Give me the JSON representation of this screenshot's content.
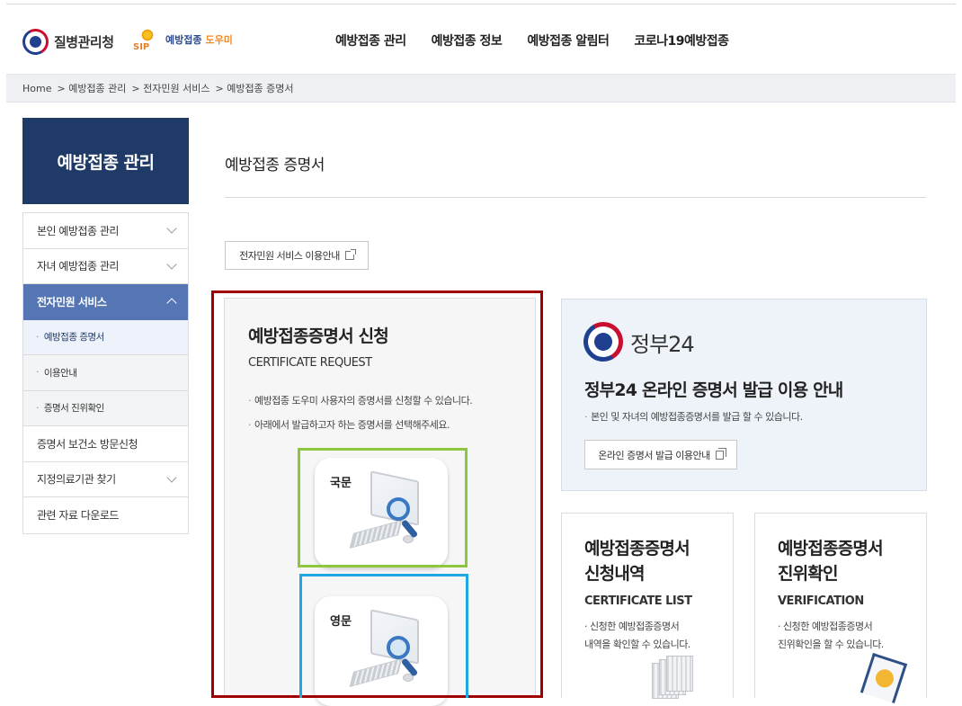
{
  "header": {
    "org_name": "질병관리청",
    "site_logo_sip": "SIP",
    "site_name_1": "예방접종",
    "site_name_2": "도우미",
    "nav": [
      "예방접종 관리",
      "예방접종 정보",
      "예방접종 알림터",
      "코로나19예방접종"
    ]
  },
  "breadcrumb": [
    "Home",
    "> 예방접종 관리",
    "> 전자민원 서비스",
    "> 예방접종 증명서"
  ],
  "sidebar": {
    "title": "예방접종 관리",
    "items": [
      {
        "label": "본인 예방접종 관리"
      },
      {
        "label": "자녀 예방접종 관리"
      },
      {
        "label": "전자민원 서비스"
      },
      {
        "label": "예방접종 증명서"
      },
      {
        "label": "이용안내"
      },
      {
        "label": "증명서 진위확인"
      },
      {
        "label": "증명서 보건소 방문신청"
      },
      {
        "label": "지정의료기관 찾기"
      },
      {
        "label": "관련 자료 다운로드"
      }
    ]
  },
  "main": {
    "page_title": "예방접종 증명서",
    "guide_button": "전자민원 서비스 이용안내",
    "request_card": {
      "title": "예방접종증명서 신청",
      "subtitle": "CERTIFICATE REQUEST",
      "bullets": [
        "예방접종 도우미 사용자의 증명서를 신청할 수 있습니다.",
        "아래에서 발급하고자 하는 증명서를 선택해주세요."
      ],
      "korean_label": "국문",
      "english_label": "영문"
    },
    "gov24_card": {
      "logo_text": "정부24",
      "title": "정부24 온라인 증명서 발급 이용 안내",
      "desc": "본인 및 자녀의 예방접종증명서를 발급 할 수 있습니다.",
      "button": "온라인 증명서 발급 이용안내"
    },
    "list_card": {
      "title": "예방접종증명서\n신청내역",
      "subtitle": "CERTIFICATE LIST",
      "desc": "· 신청한 예방접종증명서\n   내역을 확인할 수 있습니다."
    },
    "verify_card": {
      "title": "예방접종증명서\n진위확인",
      "subtitle": "VERIFICATION",
      "desc": "· 신청한 예방접종증명서\n   진위확인을 할 수 있습니다."
    }
  },
  "colors": {
    "sidebar_head": "#1f3a66",
    "sidebar_active": "#5575b5",
    "highlight_red": "#a00000",
    "highlight_green": "#8dc63f",
    "highlight_blue": "#1ea7e1"
  }
}
